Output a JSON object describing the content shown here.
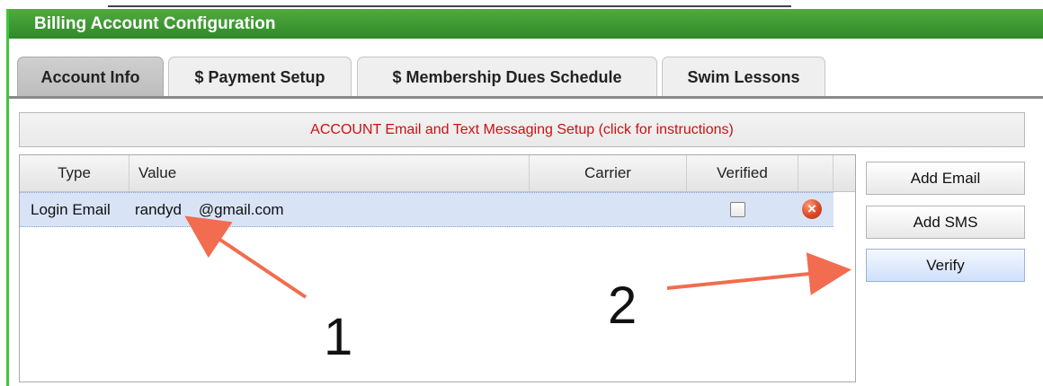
{
  "window": {
    "title": "Billing Account Configuration"
  },
  "tabs": [
    {
      "label": "Account Info",
      "active": true
    },
    {
      "label": "$ Payment Setup",
      "active": false
    },
    {
      "label": "$ Membership Dues Schedule",
      "active": false
    },
    {
      "label": "Swim Lessons",
      "active": false
    }
  ],
  "info_bar": {
    "text": "ACCOUNT Email and Text Messaging Setup (click for instructions)"
  },
  "grid": {
    "columns": [
      "Type",
      "Value",
      "Carrier",
      "Verified"
    ],
    "rows": [
      {
        "type": "Login Email",
        "value": "randyd    @gmail.com",
        "carrier": "",
        "verified": false
      }
    ]
  },
  "buttons": {
    "add_email": "Add Email",
    "add_sms": "Add SMS",
    "verify": "Verify"
  },
  "annotations": {
    "label_1": "1",
    "label_2": "2"
  },
  "colors": {
    "header_green": "#3f9b33",
    "info_red": "#cc1111",
    "row_highlight": "#d9e3f6",
    "arrow": "#f26c4f"
  }
}
